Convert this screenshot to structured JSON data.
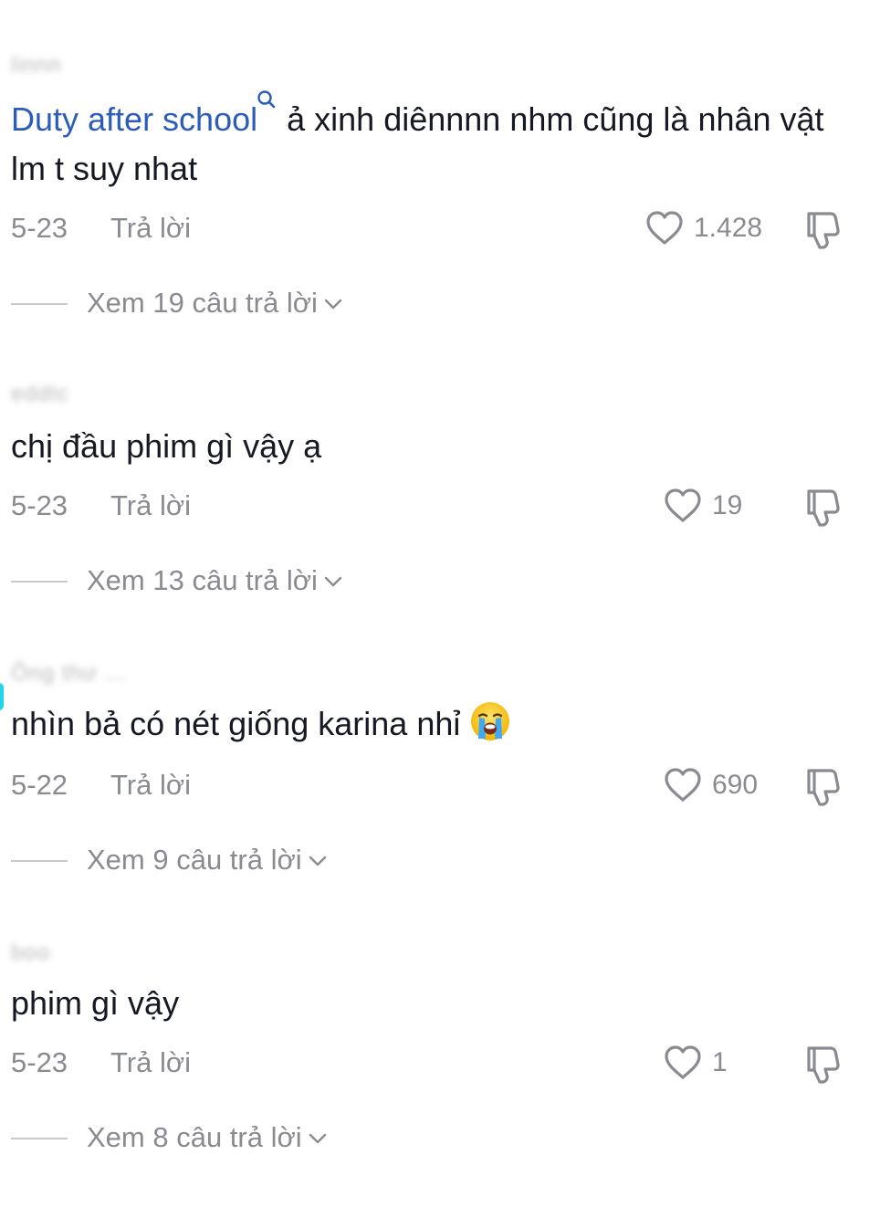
{
  "comments": [
    {
      "username": "linnn",
      "tag": "Duty after school",
      "text": "ả xinh diênnnn nhm cũng là nhân vật lm t suy nhat",
      "date": "5-23",
      "reply_label": "Trả lời",
      "likes": "1.428",
      "view_replies": "Xem 19 câu trả lời"
    },
    {
      "username": "eddtc",
      "tag": "",
      "text": "chị đầu phim gì vậy ạ",
      "date": "5-23",
      "reply_label": "Trả lời",
      "likes": "19",
      "view_replies": "Xem 13 câu trả lời"
    },
    {
      "username": "Ông thư ...",
      "tag": "",
      "text": "nhìn bả có nét giống karina nhỉ",
      "emoji": "loudly-crying-face-emoji",
      "date": "5-22",
      "reply_label": "Trả lời",
      "likes": "690",
      "view_replies": "Xem 9 câu trả lời"
    },
    {
      "username": "boo",
      "tag": "",
      "text": "phim gì vậy",
      "date": "5-23",
      "reply_label": "Trả lời",
      "likes": "1",
      "view_replies": "Xem 8 câu trả lời"
    }
  ],
  "colors": {
    "text": "#161823",
    "secondary": "#8a8b91",
    "link": "#2b5db8",
    "divider": "#c9c9cc"
  }
}
